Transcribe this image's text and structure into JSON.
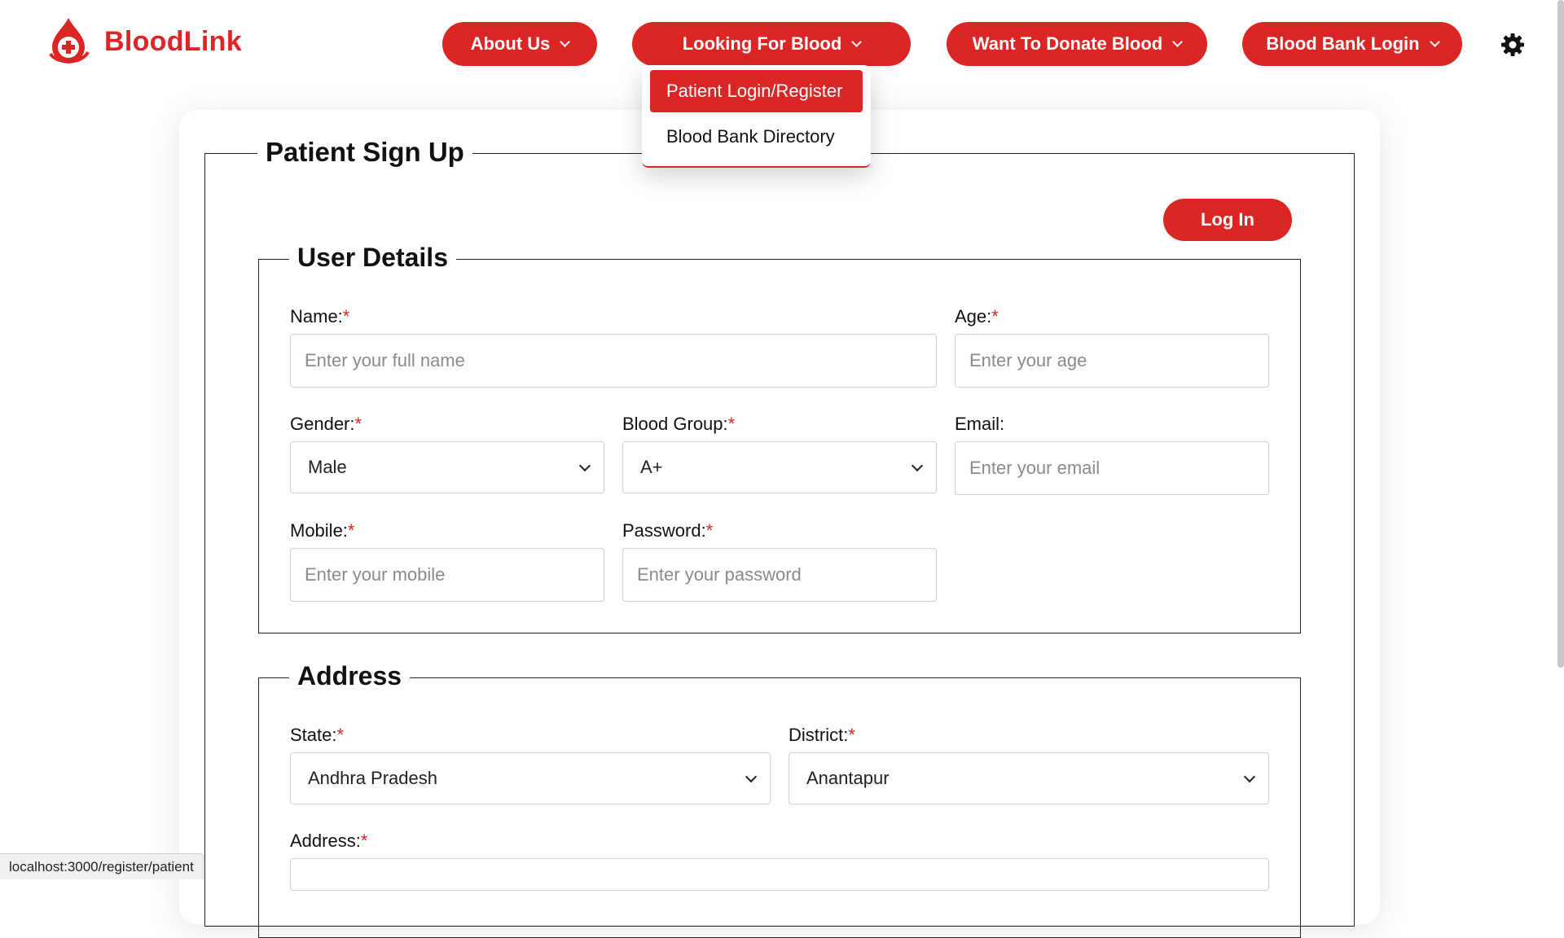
{
  "app": {
    "brand_name": "BloodLink",
    "brand_color": "#dc2626",
    "logo_icon": "blood-drop-cross-icon"
  },
  "nav": {
    "about": "About Us",
    "looking": "Looking For Blood",
    "donate": "Want To Donate Blood",
    "bank_login": "Blood Bank Login",
    "theme_icon": "gear-icon"
  },
  "dropdown": {
    "items": [
      "Patient Login/Register",
      "Blood Bank Directory"
    ]
  },
  "form": {
    "title": "Patient Sign Up",
    "login_button": "Log In",
    "user_details": {
      "legend": "User Details",
      "name_label": "Name:",
      "name_placeholder": "Enter your full name",
      "age_label": "Age:",
      "age_placeholder": "Enter your age",
      "gender_label": "Gender:",
      "gender_value": "Male",
      "blood_group_label": "Blood Group:",
      "blood_group_value": "A+",
      "email_label": "Email:",
      "email_placeholder": "Enter your email",
      "mobile_label": "Mobile:",
      "mobile_placeholder": "Enter your mobile",
      "password_label": "Password:",
      "password_placeholder": "Enter your password"
    },
    "address": {
      "legend": "Address",
      "state_label": "State:",
      "state_value": "Andhra Pradesh",
      "district_label": "District:",
      "district_value": "Anantapur",
      "address_label": "Address:"
    },
    "required_marker": "*"
  },
  "status_bar": {
    "url": "localhost:3000/register/patient"
  }
}
